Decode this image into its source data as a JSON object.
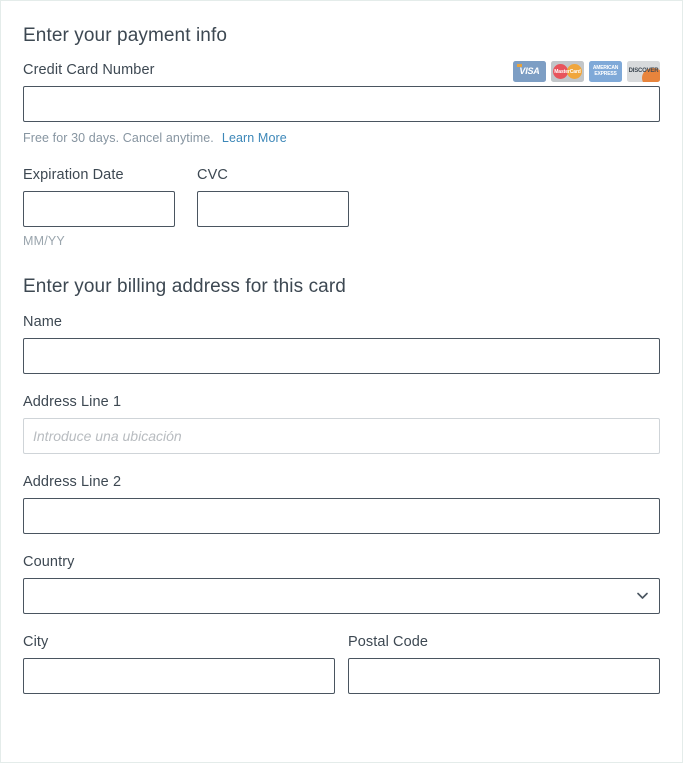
{
  "payment_section": {
    "title": "Enter your payment info",
    "credit_card": {
      "label": "Credit Card Number",
      "value": "",
      "placeholder": ""
    },
    "card_brands": [
      {
        "name": "visa-card-icon",
        "text": "VISA"
      },
      {
        "name": "mastercard-card-icon",
        "text": "MasterCard"
      },
      {
        "name": "amex-card-icon",
        "text": "AMERICAN EXPRESS"
      },
      {
        "name": "discover-card-icon",
        "text": "DISCOVER"
      }
    ],
    "helper_text": "Free for 30 days. Cancel anytime.",
    "learn_more_label": "Learn More",
    "expiration": {
      "label": "Expiration Date",
      "value": "",
      "placeholder": "",
      "hint": "MM/YY"
    },
    "cvc": {
      "label": "CVC",
      "value": "",
      "placeholder": ""
    }
  },
  "billing_section": {
    "title": "Enter your billing address for this card",
    "name": {
      "label": "Name",
      "value": "",
      "placeholder": ""
    },
    "address_line_1": {
      "label": "Address Line 1",
      "value": "",
      "placeholder": "Introduce una ubicación"
    },
    "address_line_2": {
      "label": "Address Line 2",
      "value": "",
      "placeholder": ""
    },
    "country": {
      "label": "Country",
      "selected": "",
      "options": [
        ""
      ]
    },
    "city": {
      "label": "City",
      "value": "",
      "placeholder": ""
    },
    "postal_code": {
      "label": "Postal Code",
      "value": "",
      "placeholder": ""
    }
  },
  "colors": {
    "label": "#3d4852",
    "border_dark": "#4a5560",
    "border_light": "#cfd4d8",
    "link": "#3c87b8",
    "helper": "#8795a1",
    "page_border": "#e4ecea"
  }
}
